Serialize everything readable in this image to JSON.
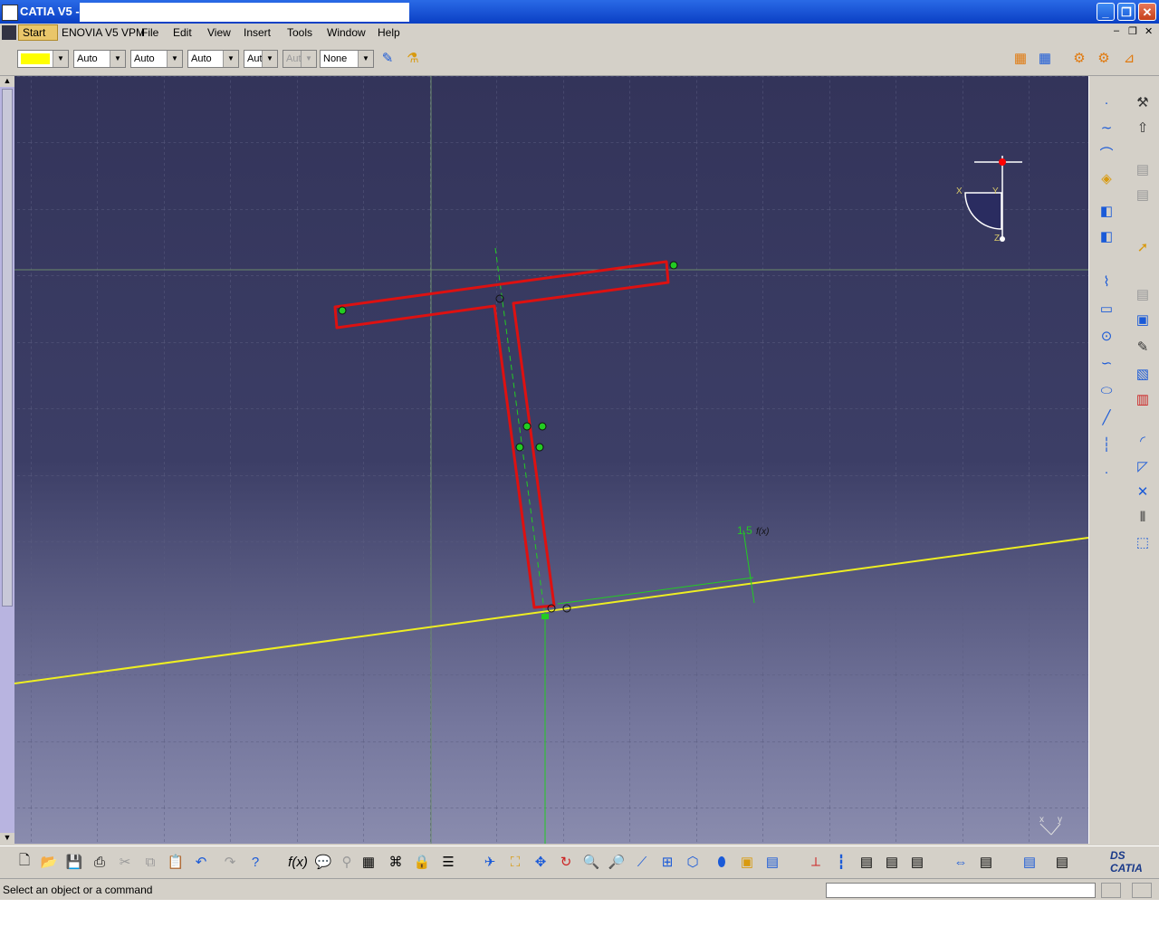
{
  "window": {
    "title": "CATIA V5 -"
  },
  "menu": {
    "items": [
      "Start",
      "ENOVIA V5 VPM",
      "File",
      "Edit",
      "View",
      "Insert",
      "Tools",
      "Window",
      "Help"
    ]
  },
  "toolbar": {
    "color_value": "",
    "line_type": "Auto",
    "thickness": "Auto",
    "point_type": "Auto",
    "layer": "Aut",
    "layer_disabled": "Aut",
    "filter": "None"
  },
  "sketch": {
    "dimension_label": "1.5",
    "formula_icon": "f(x)"
  },
  "compass_labels": {
    "x": "X",
    "y": "Y",
    "z": "Z"
  },
  "axis_labels": {
    "x": "x",
    "y": "y"
  },
  "status": {
    "message": "Select an object or a command"
  },
  "colors": {
    "profile": "#dd1111",
    "constraint": "#22cc22",
    "line": "#eeee22",
    "background_top": "#33345a",
    "background_bottom": "#8a8cae"
  },
  "icons": {
    "standard": [
      "new-icon",
      "open-icon",
      "save-icon",
      "print-icon",
      "cut-icon",
      "copy-icon",
      "paste-icon",
      "undo-icon",
      "redo-icon",
      "help-icon"
    ],
    "knowledge": [
      "formula-icon",
      "comment-icon",
      "lock-icon"
    ],
    "view": [
      "fly-icon",
      "fit-all-icon",
      "pan-icon",
      "rotate-icon",
      "zoom-in-icon",
      "zoom-out-icon",
      "normal-view-icon",
      "multi-view-icon",
      "iso-view-icon",
      "render-icon",
      "hide-show-icon",
      "swap-icon"
    ]
  }
}
